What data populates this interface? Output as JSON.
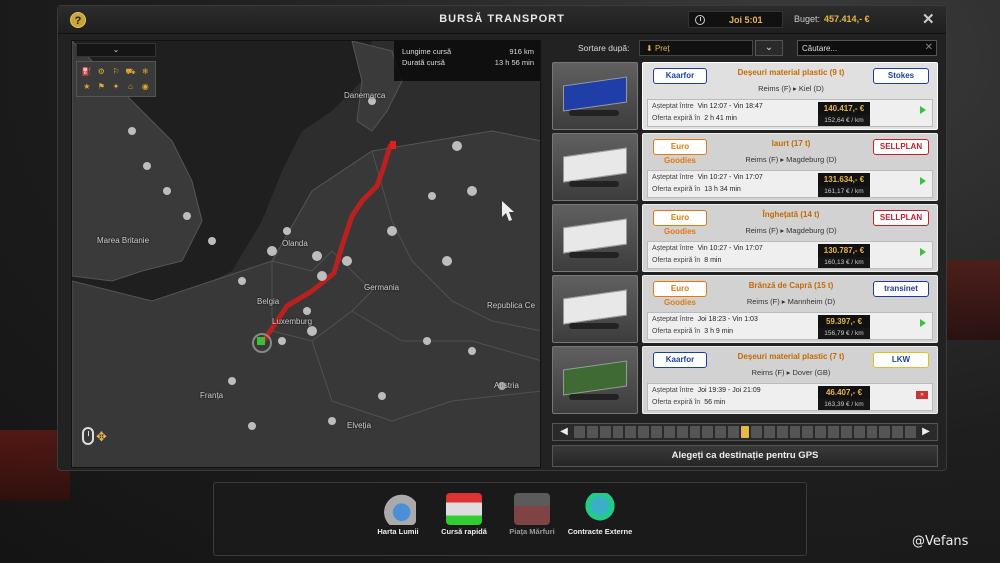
{
  "header": {
    "help_icon": "?",
    "title": "BURSĂ TRANSPORT",
    "clock": "Joi 5:01",
    "budget_label": "Buget:",
    "budget_value": "457.414,- €",
    "close_icon": "✕"
  },
  "map": {
    "info": {
      "length_label": "Lungime cursă",
      "length_value": "916 km",
      "duration_label": "Durată cursă",
      "duration_value": "13 h 56 min"
    },
    "labels": [
      "Danemarca",
      "Marea Britanie",
      "Olanda",
      "Germania",
      "Belgia",
      "Luxemburg",
      "Republica Ce",
      "Franța",
      "Elveția",
      "Austria"
    ],
    "route_color": "#c81e1e"
  },
  "sort": {
    "label": "Sortare după:",
    "selected": "Preț",
    "search_placeholder": "Căutare..."
  },
  "jobs": [
    {
      "company": "Kaarfor",
      "cargo": "Deșeuri material plastic (9 t)",
      "route": "Reims (F) ▸ Kiel (D)",
      "recipient": "Stokes",
      "waiting_label": "Așteptat între",
      "waiting": "Vin 12:07 - Vin 18:47",
      "expiry_label": "Oferta expiră în",
      "expiry": "2 h 41 min",
      "payout": "140.417,- €",
      "perkm": "152,64 € / km",
      "trailer_color": "#1f3ea8"
    },
    {
      "company": "Euro Goodies",
      "cargo": "Iaurt (17 t)",
      "route": "Reims (F) ▸ Magdeburg (D)",
      "recipient": "SELLPLAN",
      "waiting_label": "Așteptat între",
      "waiting": "Vin 10:27 - Vin 17:07",
      "expiry_label": "Oferta expiră în",
      "expiry": "13 h 34 min",
      "payout": "131.634,- €",
      "perkm": "161,17 € / km",
      "trailer_color": "#e8e8e8"
    },
    {
      "company": "Euro Goodies",
      "cargo": "Înghețată (14 t)",
      "route": "Reims (F) ▸ Magdeburg (D)",
      "recipient": "SELLPLAN",
      "waiting_label": "Așteptat între",
      "waiting": "Vin 10:27 - Vin 17:07",
      "expiry_label": "Oferta expiră în",
      "expiry": "8 min",
      "payout": "130.787,- €",
      "perkm": "160,13 € / km",
      "trailer_color": "#e8e8e8"
    },
    {
      "company": "Euro Goodies",
      "cargo": "Brânză de Capră (15 t)",
      "route": "Reims (F) ▸ Mannheim (D)",
      "recipient": "transinet",
      "waiting_label": "Așteptat între",
      "waiting": "Joi 18:23 - Vin 1:03",
      "expiry_label": "Oferta expiră în",
      "expiry": "3 h 9 min",
      "payout": "59.397,- €",
      "perkm": "156,79 € / km",
      "trailer_color": "#e8e8e8"
    },
    {
      "company": "Kaarfor",
      "cargo": "Deșeuri material plastic (7 t)",
      "route": "Reims (F) ▸ Dover (GB)",
      "recipient": "LKW",
      "waiting_label": "Așteptat între",
      "waiting": "Joi 19:39 - Joi 21:09",
      "expiry_label": "Oferta expiră în",
      "expiry": "56 min",
      "payout": "46.407,- €",
      "perkm": "163,39 € / km",
      "trailer_color": "#3f6a34"
    }
  ],
  "pager": {
    "prev": "◀",
    "next": "▶"
  },
  "gps_button": "Alegeți ca destinație pentru GPS",
  "bottom_nav": [
    {
      "label": "Harta Lumii",
      "icon": "world-map-icon",
      "active": true
    },
    {
      "label": "Cursă rapidă",
      "icon": "quick-job-icon",
      "active": true
    },
    {
      "label": "Piața Mărfuri",
      "icon": "freight-market-icon",
      "active": false
    },
    {
      "label": "Contracte Externe",
      "icon": "external-contracts-icon",
      "active": true
    }
  ],
  "watermark": "@Vefans"
}
